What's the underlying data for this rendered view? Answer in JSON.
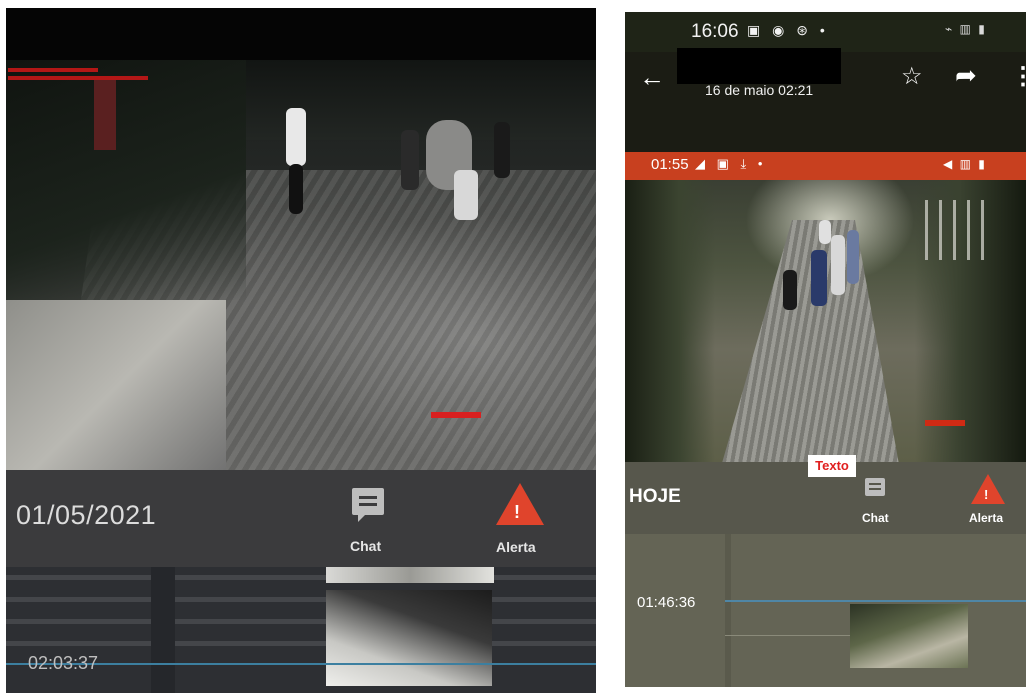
{
  "left_screenshot": {
    "date": "01/05/2021",
    "chat_label": "Chat",
    "alert_label": "Alerta",
    "alert_mark": "!",
    "timeline_time": "02:03:37",
    "accent_color": "#e0442c"
  },
  "right_screenshot": {
    "status_time": "16:06",
    "status_icons": "▣ ◉ ⊛ •",
    "status_right": "⌁ ▥ ▮",
    "back_icon": "←",
    "subtitle": "16 de maio 02:21",
    "star_icon": "☆",
    "share_icon": "➦",
    "more_icon": "⋮",
    "inner_status_time": "01:55",
    "inner_status_icons": "◢ ▣ ⤓ •",
    "inner_status_right": "◀ ▥ ▮",
    "texto_label": "Texto",
    "today_label": "HOJE",
    "chat_label": "Chat",
    "alert_label": "Alerta",
    "alert_mark": "!",
    "timeline_time": "01:46:36",
    "status_bar_color": "#c8401f"
  }
}
